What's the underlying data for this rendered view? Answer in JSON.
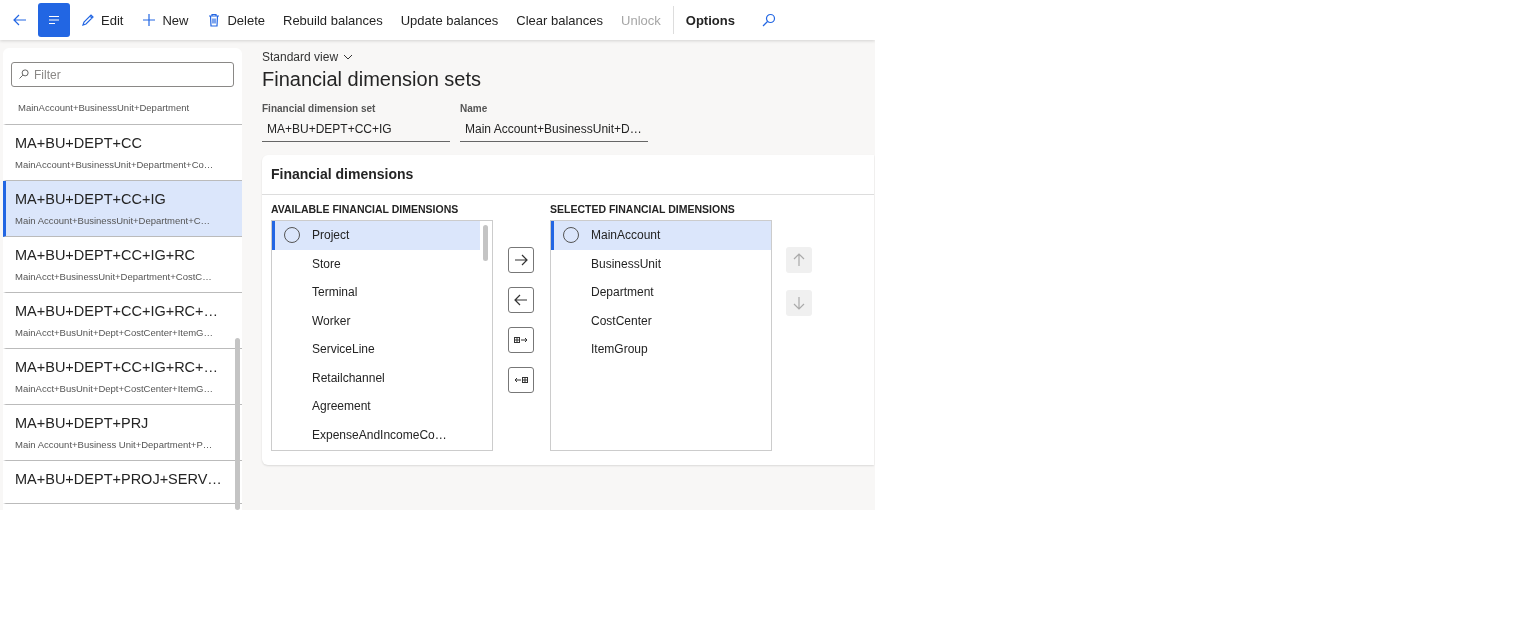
{
  "toolbar": {
    "items": [
      {
        "kind": "back",
        "selected": false
      },
      {
        "kind": "menu",
        "selected": true
      },
      {
        "kind": "edit",
        "label": "Edit",
        "disabled": false
      },
      {
        "kind": "new",
        "label": "New",
        "disabled": false
      },
      {
        "kind": "delete",
        "label": "Delete",
        "disabled": false
      },
      {
        "kind": "text",
        "label": "Rebuild balances",
        "disabled": false
      },
      {
        "kind": "text",
        "label": "Update balances",
        "disabled": false
      },
      {
        "kind": "text",
        "label": "Clear balances",
        "disabled": false
      },
      {
        "kind": "text",
        "label": "Unlock",
        "disabled": true
      },
      {
        "kind": "divider"
      },
      {
        "kind": "strong",
        "label": "Options",
        "disabled": false
      },
      {
        "kind": "search"
      }
    ]
  },
  "sidebar": {
    "filter": {
      "placeholder": "Filter"
    },
    "items": [
      {
        "subtitle": "MainAccount+BusinessUnit+Department",
        "selected": false
      },
      {
        "title": "MA+BU+DEPT+CC",
        "subtitle": "MainAccount+BusinessUnit+Department+Co…",
        "selected": false
      },
      {
        "title": "MA+BU+DEPT+CC+IG",
        "subtitle": "Main Account+BusinessUnit+Department+C…",
        "selected": true
      },
      {
        "title": "MA+BU+DEPT+CC+IG+RC",
        "subtitle": "MainAcct+BusinessUnit+Department+CostC…",
        "selected": false
      },
      {
        "title": "MA+BU+DEPT+CC+IG+RC+…",
        "subtitle": "MainAcct+BusUnit+Dept+CostCenter+ItemG…",
        "selected": false
      },
      {
        "title": "MA+BU+DEPT+CC+IG+RC+…",
        "subtitle": "MainAcct+BusUnit+Dept+CostCenter+ItemG…",
        "selected": false
      },
      {
        "title": "MA+BU+DEPT+PRJ",
        "subtitle": "Main Account+Business Unit+Department+P…",
        "selected": false
      },
      {
        "title": "MA+BU+DEPT+PROJ+SERV…",
        "selected": false
      }
    ]
  },
  "view_selector": "Standard view",
  "page_title": "Financial dimension sets",
  "fields": [
    {
      "label": "Financial dimension set",
      "value": "MA+BU+DEPT+CC+IG"
    },
    {
      "label": "Name",
      "value": "Main Account+BusinessUnit+D…"
    }
  ],
  "section": {
    "title": "Financial dimensions",
    "available": {
      "heading": "AVAILABLE FINANCIAL DIMENSIONS",
      "items": [
        {
          "label": "Project",
          "selected": true
        },
        {
          "label": "Store",
          "selected": false
        },
        {
          "label": "Terminal",
          "selected": false
        },
        {
          "label": "Worker",
          "selected": false
        },
        {
          "label": "ServiceLine",
          "selected": false
        },
        {
          "label": "Retailchannel",
          "selected": false
        },
        {
          "label": "Agreement",
          "selected": false
        },
        {
          "label": "ExpenseAndIncomeCo…",
          "selected": false
        }
      ]
    },
    "transfer_buttons": [
      {
        "kind": "add"
      },
      {
        "kind": "remove"
      },
      {
        "kind": "add_all"
      },
      {
        "kind": "remove_all"
      }
    ],
    "selected": {
      "heading": "SELECTED FINANCIAL DIMENSIONS",
      "items": [
        {
          "label": "MainAccount",
          "selected": true
        },
        {
          "label": "BusinessUnit",
          "selected": false
        },
        {
          "label": "Department",
          "selected": false
        },
        {
          "label": "CostCenter",
          "selected": false
        },
        {
          "label": "ItemGroup",
          "selected": false
        }
      ]
    },
    "move_buttons": [
      {
        "kind": "up",
        "disabled": true
      },
      {
        "kind": "down",
        "disabled": true
      }
    ]
  }
}
